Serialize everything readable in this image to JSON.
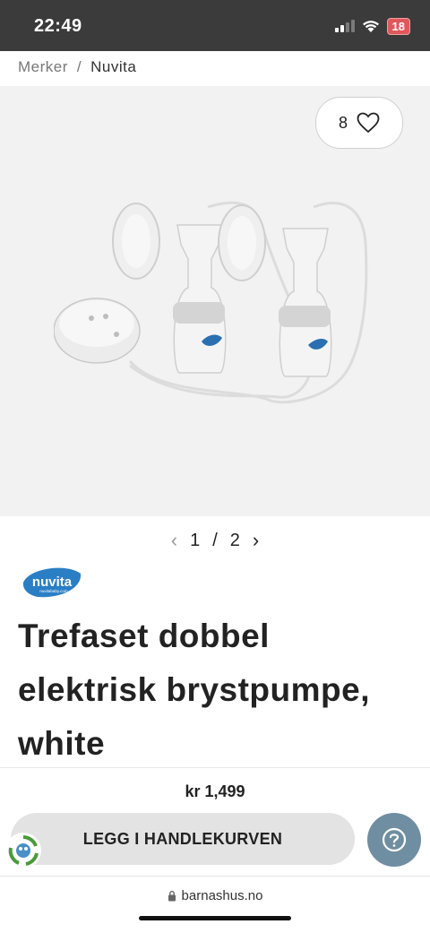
{
  "status_bar": {
    "time": "22:49",
    "battery": "18"
  },
  "breadcrumb": {
    "items": [
      "Merker",
      "Nuvita"
    ],
    "separator": "/"
  },
  "gallery": {
    "favorite_count": "8",
    "current": "1",
    "separator": "/",
    "total": "2"
  },
  "brand": {
    "logo_text": "nuvita",
    "logo_subtext": "nuvitababy.com"
  },
  "product": {
    "title": "Trefaset dobbel elektrisk brystpumpe, white",
    "price": "kr 1,499"
  },
  "actions": {
    "add_to_cart": "LEGG I HANDLEKURVEN",
    "help_icon": "question-icon"
  },
  "browser": {
    "url": "barnashus.no"
  },
  "colors": {
    "status_bar": "#3b3b3b",
    "help_button": "#6f8ea2",
    "cart_button": "#e3e3e3",
    "brand_blue": "#2a7fc4"
  }
}
